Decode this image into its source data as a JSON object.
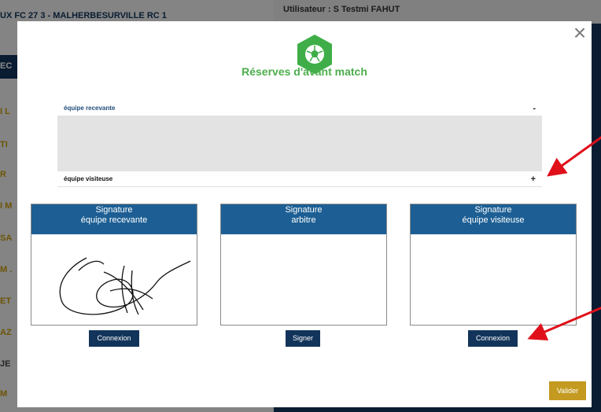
{
  "background": {
    "match_title": "UX FC 27 3 - MALHERBESURVILLE RC 1",
    "user_label": "Utilisateur : S Testmi FAHUT",
    "cut_letters": [
      "EC",
      "I L",
      "TI",
      "R",
      "I M",
      "SA",
      "M .",
      "ET",
      "AZ",
      "JE",
      "M"
    ]
  },
  "modal": {
    "title": "Réserves d'avant match",
    "close_label": "×",
    "home_team_label": "équipe recevante",
    "home_toggle": "-",
    "away_team_label": "équipe visiteuse",
    "away_toggle": "+",
    "signatures": [
      {
        "line1": "Signature",
        "line2": "équipe recevante",
        "button": "Connexion"
      },
      {
        "line1": "Signature",
        "line2": "arbitre",
        "button": "Signer"
      },
      {
        "line1": "Signature",
        "line2": "équipe visiteuse",
        "button": "Connexion"
      }
    ],
    "validate_label": "Valider"
  },
  "icons": {
    "badge": "soccer-ball-icon",
    "close": "close-icon",
    "annotation": "red-arrow-icon"
  },
  "colors": {
    "title_green": "#4cae4c",
    "header_blue": "#1d5f94",
    "button_navy": "#12345a",
    "validate_gold": "#c49a20",
    "arrow_red": "#e0101a"
  }
}
